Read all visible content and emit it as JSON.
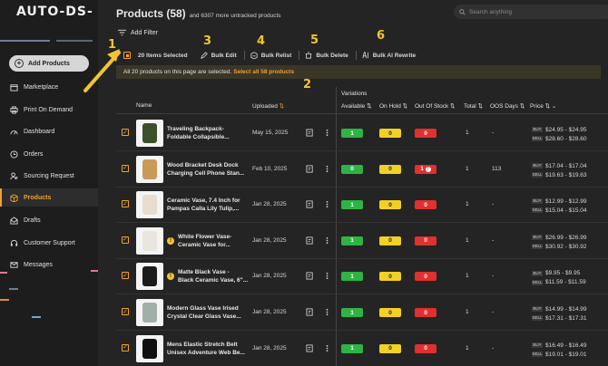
{
  "app": {
    "logo": "AUTO-DS-"
  },
  "sidebar": {
    "add_button": "Add Products",
    "items": [
      {
        "label": "Marketplace",
        "icon": "store-icon"
      },
      {
        "label": "Print On Demand",
        "icon": "printer-icon"
      },
      {
        "label": "Dashboard",
        "icon": "gauge-icon"
      },
      {
        "label": "Orders",
        "icon": "clock-icon"
      },
      {
        "label": "Sourcing Request",
        "icon": "person-search-icon"
      },
      {
        "label": "Products",
        "icon": "box-icon",
        "active": true
      },
      {
        "label": "Drafts",
        "icon": "drafts-icon"
      },
      {
        "label": "Customer Support",
        "icon": "headset-icon"
      },
      {
        "label": "Messages",
        "icon": "mail-icon"
      }
    ]
  },
  "header": {
    "title": "Products (58)",
    "subtitle": "and 6307 more untracked products",
    "search_placeholder": "Search anything"
  },
  "filter": {
    "label": "Add Filter"
  },
  "bulk": {
    "selected": "20 Items Selected",
    "actions": [
      "Bulk Edit",
      "Bulk Relist",
      "Bulk Delete",
      "Bulk AI Rewrite"
    ]
  },
  "banner": {
    "text": "All 20 products on this page are selected.",
    "link": "Select all 58 products"
  },
  "callouts": [
    "1",
    "2",
    "3",
    "4",
    "5",
    "6"
  ],
  "table": {
    "group_header": "Variations",
    "columns": {
      "name": "Name",
      "uploaded": "Uploaded",
      "available": "Available",
      "on_hold": "On Hold",
      "out_of_stock": "Out Of Stock",
      "total": "Total",
      "oos_days": "OOS Days",
      "price": "Price"
    },
    "price_labels": {
      "buy": "BUY",
      "sell": "SELL"
    },
    "rows": [
      {
        "name1": "Traveling Backpack-",
        "name2": "Foldable Collapsible...",
        "date": "May 15, 2025",
        "available": "1",
        "on_hold": "0",
        "oos": "0",
        "total": "1",
        "oos_days": "-",
        "buy": "$24.95 - $24.95",
        "sell": "$28.60 - $28.60",
        "warn": false,
        "oos_alert": false
      },
      {
        "name1": "Wood Bracket Desk Dock",
        "name2": "Charging Cell Phone Stan...",
        "date": "Feb 10, 2025",
        "available": "0",
        "on_hold": "0",
        "oos": "1",
        "total": "1",
        "oos_days": "113",
        "buy": "$17.04 - $17.04",
        "sell": "$19.63 - $19.63",
        "warn": false,
        "oos_alert": true
      },
      {
        "name1": "Ceramic Vase, 7.4 Inch for",
        "name2": "Pampas Calla Lily Tulip,...",
        "date": "Jan 28, 2025",
        "available": "1",
        "on_hold": "0",
        "oos": "0",
        "total": "1",
        "oos_days": "-",
        "buy": "$12.99 - $12.99",
        "sell": "$15.04 - $15.04",
        "warn": false,
        "oos_alert": false
      },
      {
        "name1": "White Flower Vase-",
        "name2": "Ceramic Vase for...",
        "date": "Jan 28, 2025",
        "available": "1",
        "on_hold": "0",
        "oos": "0",
        "total": "1",
        "oos_days": "-",
        "buy": "$26.99 - $26.99",
        "sell": "$30.92 - $30.92",
        "warn": true,
        "oos_alert": false
      },
      {
        "name1": "Matte Black Vase -",
        "name2": "Black Ceramic Vase, 6\"...",
        "date": "Jan 28, 2025",
        "available": "1",
        "on_hold": "0",
        "oos": "0",
        "total": "1",
        "oos_days": "-",
        "buy": "$9.95 - $9.95",
        "sell": "$11.59 - $11.59",
        "warn": true,
        "oos_alert": false
      },
      {
        "name1": "Modern Glass Vase Irised",
        "name2": "Crystal Clear Glass Vase...",
        "date": "Jan 28, 2025",
        "available": "1",
        "on_hold": "0",
        "oos": "0",
        "total": "1",
        "oos_days": "-",
        "buy": "$14.99 - $14.99",
        "sell": "$17.31 - $17.31",
        "warn": false,
        "oos_alert": false
      },
      {
        "name1": "Mens Elastic Stretch Belt",
        "name2": "Unisex Adventure Web Be...",
        "date": "Jan 28, 2025",
        "available": "1",
        "on_hold": "0",
        "oos": "0",
        "total": "1",
        "oos_days": "-",
        "buy": "$16.49 - $16.49",
        "sell": "$19.01 - $19.01",
        "warn": false,
        "oos_alert": false
      }
    ]
  },
  "colors": {
    "accent": "#f0a030",
    "callout": "#f5c430",
    "available": "#2fb344",
    "on_hold": "#f2d024",
    "out_of_stock": "#e03030"
  }
}
